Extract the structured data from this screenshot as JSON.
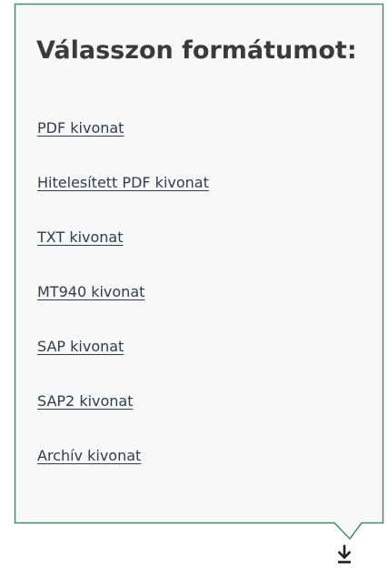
{
  "popover": {
    "title": "Válasszon formátumot:",
    "border_color": "#4a8a6b",
    "background_color": "#f8f8f8",
    "items": [
      {
        "label": "PDF kivonat"
      },
      {
        "label": "Hitelesített PDF kivonat"
      },
      {
        "label": "TXT kivonat"
      },
      {
        "label": "MT940 kivonat"
      },
      {
        "label": "SAP kivonat"
      },
      {
        "label": "SAP2 kivonat"
      },
      {
        "label": "Archív kivonat"
      }
    ]
  },
  "download_button": {
    "icon": "download-icon"
  }
}
